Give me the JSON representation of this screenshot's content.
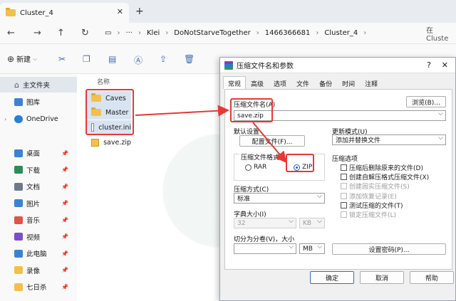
{
  "explorer": {
    "tab_title": "Cluster_4",
    "breadcrumbs": [
      "Klei",
      "DoNotStarveTogether",
      "1466366681",
      "Cluster_4"
    ],
    "search_placeholder": "在 Cluste",
    "new_label": "新建",
    "column_name": "名称",
    "sidebar": {
      "home": "主文件夹",
      "gallery": "图库",
      "onedrive": "OneDrive",
      "pinned": [
        {
          "label": "桌面",
          "color": "#3b82d6"
        },
        {
          "label": "下载",
          "color": "#2e8b57"
        },
        {
          "label": "文档",
          "color": "#6a7a8c"
        },
        {
          "label": "图片",
          "color": "#3b82d6"
        },
        {
          "label": "音乐",
          "color": "#e0524a"
        },
        {
          "label": "视频",
          "color": "#7b4fc9"
        },
        {
          "label": "此电脑",
          "color": "#3b82d6"
        },
        {
          "label": "录像",
          "color": "#f3c04c"
        },
        {
          "label": "七日杀",
          "color": "#f3c04c"
        }
      ]
    },
    "files": [
      "Caves",
      "Master",
      "cluster.ini",
      "save.zip"
    ]
  },
  "dialog": {
    "title": "压缩文件名和参数",
    "tabs": [
      "常规",
      "高级",
      "选项",
      "文件",
      "备份",
      "时间",
      "注释"
    ],
    "archive_name_label": "压缩文件名(A)",
    "archive_name": "save.zip",
    "browse": "浏览(B)...",
    "default_settings": "默认设置",
    "profiles": "配置文件(F)...",
    "update_mode_label": "更新模式(U)",
    "update_mode": "添加并替换文件",
    "format_label": "压缩文件格式",
    "format_rar": "RAR",
    "format_zip": "ZIP",
    "options_label": "压缩选项",
    "options": [
      {
        "label": "压缩后删除原来的文件(D)",
        "disabled": false
      },
      {
        "label": "创建自解压格式压缩文件(X)",
        "disabled": false
      },
      {
        "label": "创建固实压缩文件(S)",
        "disabled": true
      },
      {
        "label": "添加恢复记录(E)",
        "disabled": true
      },
      {
        "label": "测试压缩的文件(T)",
        "disabled": false
      },
      {
        "label": "锁定压缩文件(L)",
        "disabled": true
      }
    ],
    "method_label": "压缩方式(C)",
    "method": "标准",
    "dict_label": "字典大小(I)",
    "dict_size": "32",
    "dict_unit": "KB",
    "split_label": "切分为分卷(V)，大小",
    "split_unit": "MB",
    "set_password": "设置密码(P)...",
    "ok": "确定",
    "cancel": "取消",
    "help": "帮助"
  }
}
